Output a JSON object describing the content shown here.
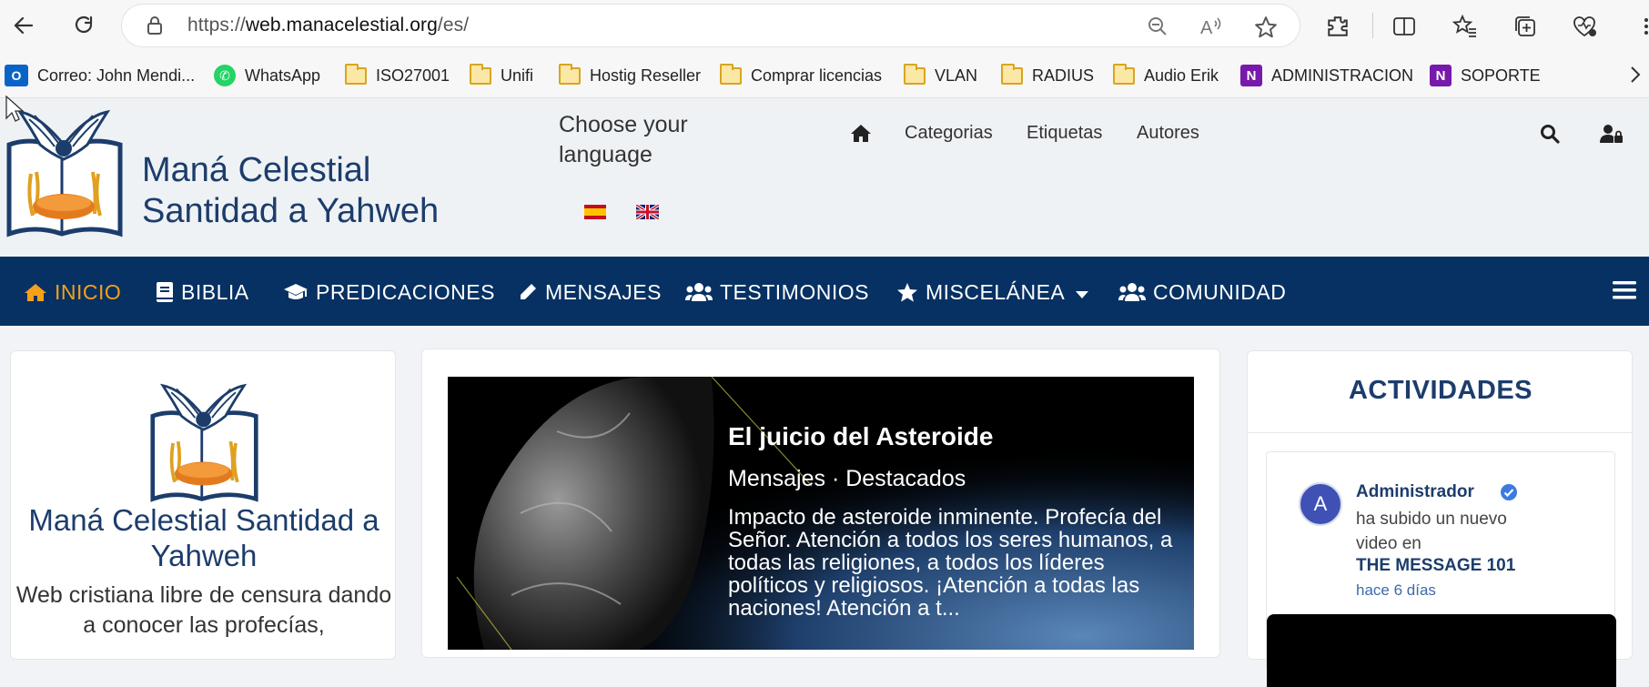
{
  "browser": {
    "url_prefix": "https://",
    "url_host": "web.manacelestial.org",
    "url_path": "/es/"
  },
  "bookmarks": [
    {
      "label": "Correo: John Mendi...",
      "icon": "outlook-icon"
    },
    {
      "label": "WhatsApp",
      "icon": "whatsapp-icon"
    },
    {
      "label": "ISO27001",
      "icon": "folder-icon"
    },
    {
      "label": "Unifi",
      "icon": "folder-icon"
    },
    {
      "label": "Hostig Reseller",
      "icon": "folder-icon"
    },
    {
      "label": "Comprar licencias",
      "icon": "folder-icon"
    },
    {
      "label": "VLAN",
      "icon": "folder-icon"
    },
    {
      "label": "RADIUS",
      "icon": "folder-icon"
    },
    {
      "label": "Audio Erik",
      "icon": "folder-icon"
    },
    {
      "label": "ADMINISTRACION",
      "icon": "onenote-icon"
    },
    {
      "label": "SOPORTE",
      "icon": "onenote-icon"
    }
  ],
  "header": {
    "title_line1": "Maná Celestial",
    "title_line2": "Santidad a Yahweh",
    "language_prompt": "Choose your language",
    "menu": [
      "Categorias",
      "Etiquetas",
      "Autores"
    ]
  },
  "mainnav": [
    {
      "label": "INICIO",
      "icon": "home-icon",
      "active": true
    },
    {
      "label": "BIBLIA",
      "icon": "book-icon"
    },
    {
      "label": "PREDICACIONES",
      "icon": "graduation-cap-icon"
    },
    {
      "label": "MENSAJES",
      "icon": "pencil-icon"
    },
    {
      "label": "TESTIMONIOS",
      "icon": "users-icon"
    },
    {
      "label": "MISCELÁNEA",
      "icon": "star-icon"
    },
    {
      "label": "COMUNIDAD",
      "icon": "users-icon"
    }
  ],
  "sidebar": {
    "title": "Maná Celestial Santidad a Yahweh",
    "description": "Web cristiana libre de censura dando a conocer las profecías,"
  },
  "featured": {
    "title": "El juicio del Asteroide",
    "categories": "Mensajes · Destacados",
    "excerpt": "Impacto de asteroide inminente. Profecía del Señor. Atención a todos los seres humanos, a todas las religiones, a todos los líderes políticos y religiosos. ¡Atención a todas las naciones! Atención a t..."
  },
  "activities": {
    "heading": "ACTIVIDADES",
    "item": {
      "avatar_letter": "A",
      "user": "Administrador",
      "text": "ha subido un nuevo video en",
      "link": "THE MESSAGE 101",
      "time": "hace 6 días"
    }
  },
  "colors": {
    "nav_bg": "#073163",
    "active": "#f5a01a",
    "brand_text": "#1c3d6b"
  }
}
